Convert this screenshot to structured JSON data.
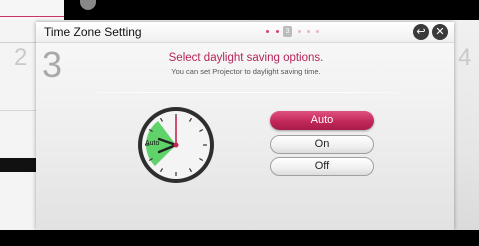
{
  "dialog": {
    "title": "Time Zone Setting",
    "step_number": "3",
    "heading": "Select daylight saving options.",
    "subheading": "You can set Projector to daylight saving time.",
    "current_page_marker": "3"
  },
  "side_numbers": {
    "previous": "2",
    "next": "4"
  },
  "clock": {
    "label": "Auto"
  },
  "options": [
    {
      "label": "Auto",
      "selected": true
    },
    {
      "label": "On",
      "selected": false
    },
    {
      "label": "Off",
      "selected": false
    }
  ],
  "header_buttons": {
    "back_icon": "back-icon",
    "close_icon": "close-icon"
  },
  "colors": {
    "accent": "#c2285a",
    "heading": "#b5255a",
    "clock_sector": "#5fd36a"
  }
}
